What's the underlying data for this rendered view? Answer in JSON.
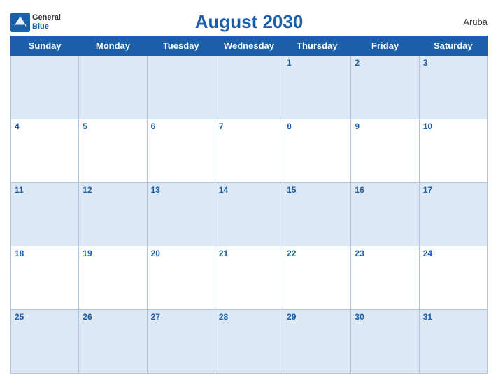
{
  "header": {
    "title": "August 2030",
    "country": "Aruba",
    "logo_general": "General",
    "logo_blue": "Blue"
  },
  "days_of_week": [
    "Sunday",
    "Monday",
    "Tuesday",
    "Wednesday",
    "Thursday",
    "Friday",
    "Saturday"
  ],
  "weeks": [
    [
      "",
      "",
      "",
      "",
      "1",
      "2",
      "3"
    ],
    [
      "4",
      "5",
      "6",
      "7",
      "8",
      "9",
      "10"
    ],
    [
      "11",
      "12",
      "13",
      "14",
      "15",
      "16",
      "17"
    ],
    [
      "18",
      "19",
      "20",
      "21",
      "22",
      "23",
      "24"
    ],
    [
      "25",
      "26",
      "27",
      "28",
      "29",
      "30",
      "31"
    ]
  ]
}
